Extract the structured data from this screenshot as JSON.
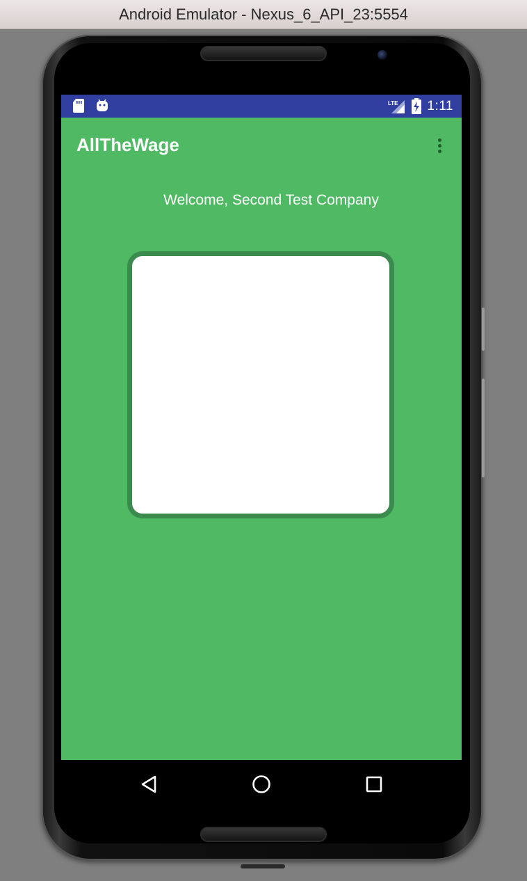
{
  "window": {
    "title": "Android Emulator - Nexus_6_API_23:5554"
  },
  "status_bar": {
    "left_icons": [
      "sd-card-icon",
      "android-debug-icon"
    ],
    "network_label": "LTE",
    "time": "1:11",
    "color": "#303f9f"
  },
  "app_bar": {
    "title": "AllTheWage",
    "menu_icon": "overflow-menu-icon",
    "color": "#4fb963"
  },
  "main": {
    "welcome_text": "Welcome, Second Test Company",
    "card_border_color": "#3b8a4e",
    "card_fill_color": "#ffffff"
  },
  "nav_bar": {
    "buttons": [
      "back-icon",
      "home-icon",
      "recents-icon"
    ]
  }
}
